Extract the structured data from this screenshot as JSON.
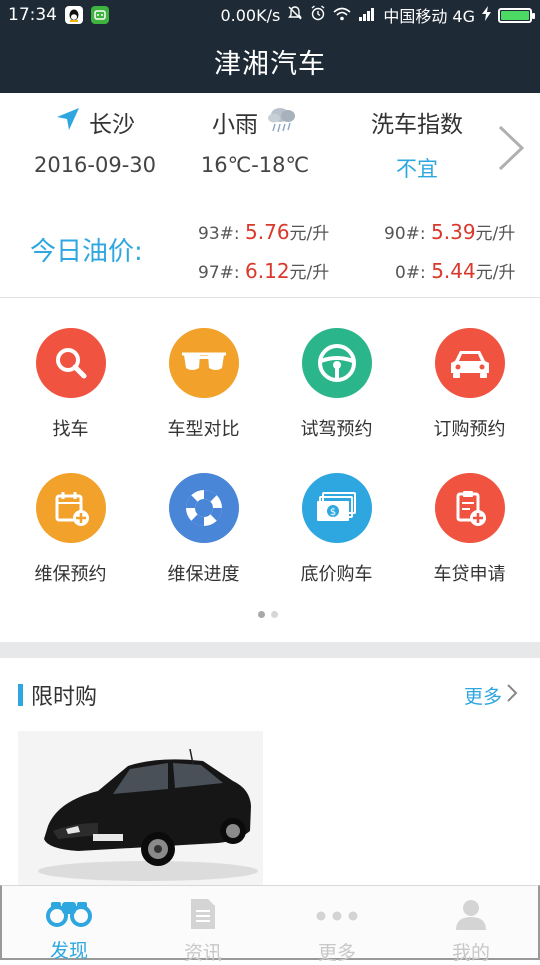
{
  "status_bar": {
    "time": "17:34",
    "speed": "0.00K/s",
    "carrier": "中国移动 4G"
  },
  "header": {
    "title": "津湘汽车"
  },
  "info": {
    "location": {
      "city": "长沙",
      "date": "2016-09-30"
    },
    "weather": {
      "condition": "小雨",
      "temperature": "16℃-18℃"
    },
    "car_wash": {
      "label": "洗车指数",
      "value": "不宜"
    }
  },
  "oil": {
    "label": "今日油价:",
    "unit": "元/升",
    "prices": [
      {
        "grade": "93#:",
        "value": "5.76"
      },
      {
        "grade": "90#:",
        "value": "5.39"
      },
      {
        "grade": "97#:",
        "value": "6.12"
      },
      {
        "grade": "0#:",
        "value": "5.44"
      }
    ]
  },
  "grid": [
    {
      "label": "找车",
      "icon": "search-icon",
      "color": "#f0533f"
    },
    {
      "label": "车型对比",
      "icon": "glasses-icon",
      "color": "#f2a12a"
    },
    {
      "label": "试驾预约",
      "icon": "steering-wheel-icon",
      "color": "#2bb58a"
    },
    {
      "label": "订购预约",
      "icon": "car-icon",
      "color": "#f0533f"
    },
    {
      "label": "维保预约",
      "icon": "calendar-add-icon",
      "color": "#f2a12a"
    },
    {
      "label": "维保进度",
      "icon": "lifebuoy-icon",
      "color": "#4a86d8"
    },
    {
      "label": "底价购车",
      "icon": "money-icon",
      "color": "#2ea7e0"
    },
    {
      "label": "车贷申请",
      "icon": "clipboard-add-icon",
      "color": "#f0533f"
    }
  ],
  "flash_sale": {
    "title": "限时购",
    "more": "更多"
  },
  "tabs": [
    {
      "label": "发现",
      "icon": "binoculars-icon",
      "active": true
    },
    {
      "label": "资讯",
      "icon": "document-icon",
      "active": false
    },
    {
      "label": "更多",
      "icon": "more-dots-icon",
      "active": false
    },
    {
      "label": "我的",
      "icon": "user-icon",
      "active": false
    }
  ],
  "colors": {
    "header_bg": "#1e2a36",
    "accent": "#2ea7e0",
    "price_red": "#d9382b"
  }
}
